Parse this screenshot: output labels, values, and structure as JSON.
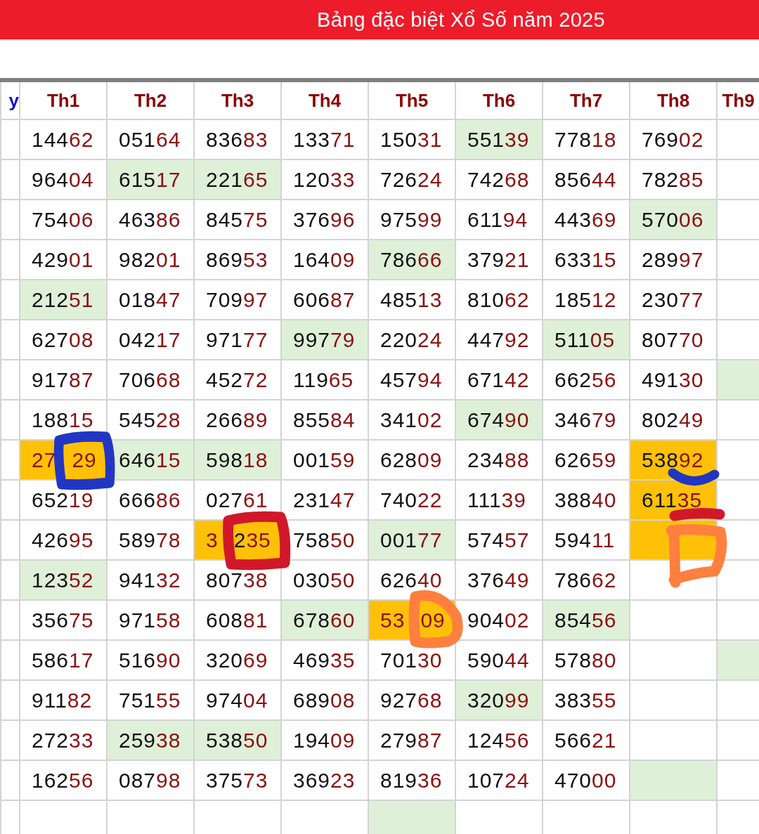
{
  "title": "Bảng đặc biệt Xổ Số năm 2025",
  "table": {
    "columns": [
      "y",
      "Th1",
      "Th2",
      "Th3",
      "Th4",
      "Th5",
      "Th6",
      "Th7",
      "Th8",
      "Th9"
    ],
    "rows": [
      [
        {},
        {
          "parts": [
            "14462"
          ]
        },
        {
          "parts": [
            "05164"
          ]
        },
        {
          "parts": [
            "83683"
          ]
        },
        {
          "parts": [
            "13371"
          ]
        },
        {
          "parts": [
            "15031"
          ]
        },
        {
          "parts": [
            "55139"
          ],
          "color": "#dff0d8"
        },
        {
          "parts": [
            "77818"
          ]
        },
        {
          "parts": [
            "76902"
          ]
        },
        {}
      ],
      [
        {},
        {
          "parts": [
            "96404"
          ]
        },
        {
          "parts": [
            "61517"
          ],
          "color": "#dff0d8"
        },
        {
          "parts": [
            "22165"
          ],
          "color": "#dff0d8"
        },
        {
          "parts": [
            "12033"
          ]
        },
        {
          "parts": [
            "72624"
          ]
        },
        {
          "parts": [
            "74268"
          ]
        },
        {
          "parts": [
            "85644"
          ]
        },
        {
          "parts": [
            "78285"
          ]
        },
        {}
      ],
      [
        {},
        {
          "parts": [
            "75406"
          ]
        },
        {
          "parts": [
            "46386"
          ]
        },
        {
          "parts": [
            "84575"
          ]
        },
        {
          "parts": [
            "37696"
          ]
        },
        {
          "parts": [
            "97599"
          ]
        },
        {
          "parts": [
            "61194"
          ]
        },
        {
          "parts": [
            "44369"
          ]
        },
        {
          "parts": [
            "57006"
          ],
          "color": "#dff0d8"
        },
        {}
      ],
      [
        {},
        {
          "parts": [
            "42901"
          ]
        },
        {
          "parts": [
            "98201"
          ]
        },
        {
          "parts": [
            "86953"
          ]
        },
        {
          "parts": [
            "16409"
          ]
        },
        {
          "parts": [
            "78666"
          ],
          "color": "#dff0d8"
        },
        {
          "parts": [
            "37921"
          ]
        },
        {
          "parts": [
            "63315"
          ]
        },
        {
          "parts": [
            "28997"
          ]
        },
        {}
      ],
      [
        {},
        {
          "parts": [
            "21251"
          ],
          "color": "#dff0d8"
        },
        {
          "parts": [
            "01847"
          ]
        },
        {
          "parts": [
            "70997"
          ]
        },
        {
          "parts": [
            "60687"
          ]
        },
        {
          "parts": [
            "48513"
          ]
        },
        {
          "parts": [
            "81062"
          ]
        },
        {
          "parts": [
            "18512"
          ]
        },
        {
          "parts": [
            "23077"
          ]
        },
        {}
      ],
      [
        {},
        {
          "parts": [
            "62708"
          ]
        },
        {
          "parts": [
            "04217"
          ]
        },
        {
          "parts": [
            "97177"
          ]
        },
        {
          "parts": [
            "99779"
          ],
          "color": "#dff0d8"
        },
        {
          "parts": [
            "22024"
          ]
        },
        {
          "parts": [
            "44792"
          ]
        },
        {
          "parts": [
            "51105"
          ],
          "color": "#dff0d8"
        },
        {
          "parts": [
            "80770"
          ]
        },
        {}
      ],
      [
        {},
        {
          "parts": [
            "91787"
          ]
        },
        {
          "parts": [
            "70668"
          ]
        },
        {
          "parts": [
            "45272"
          ]
        },
        {
          "parts": [
            "11965"
          ]
        },
        {
          "parts": [
            "45794"
          ]
        },
        {
          "parts": [
            "67142"
          ]
        },
        {
          "parts": [
            "66256"
          ]
        },
        {
          "parts": [
            "49130"
          ]
        },
        {
          "color": "#dff0d8"
        }
      ],
      [
        {},
        {
          "parts": [
            "18815"
          ]
        },
        {
          "parts": [
            "54528"
          ]
        },
        {
          "parts": [
            "26689"
          ]
        },
        {
          "parts": [
            "85584"
          ]
        },
        {
          "parts": [
            "34102"
          ]
        },
        {
          "parts": [
            "67490"
          ],
          "color": "#dff0d8"
        },
        {
          "parts": [
            "34679"
          ]
        },
        {
          "parts": [
            "80249"
          ]
        },
        {}
      ],
      [
        {},
        {
          "parts": [
            "27",
            "29"
          ],
          "color": "#ffc107",
          "mark": {
            "kind": "ring",
            "color": "#2236c4"
          }
        },
        {
          "parts": [
            "64615"
          ],
          "color": "#dff0d8"
        },
        {
          "parts": [
            "59818"
          ],
          "color": "#dff0d8"
        },
        {
          "parts": [
            "00159"
          ]
        },
        {
          "parts": [
            "62809"
          ]
        },
        {
          "parts": [
            "23488"
          ]
        },
        {
          "parts": [
            "62659"
          ]
        },
        {
          "parts": [
            "53892"
          ],
          "color": "#ffc107",
          "mark": {
            "kind": "arc",
            "color": "#2236c4"
          }
        },
        {}
      ],
      [
        {},
        {
          "parts": [
            "65219"
          ]
        },
        {
          "parts": [
            "66686"
          ]
        },
        {
          "parts": [
            "02761"
          ]
        },
        {
          "parts": [
            "23147"
          ]
        },
        {
          "parts": [
            "74022"
          ]
        },
        {
          "parts": [
            "11139"
          ]
        },
        {
          "parts": [
            "38840"
          ]
        },
        {
          "parts": [
            "61135"
          ],
          "color": "#ffc107",
          "mark": {
            "kind": "bar",
            "color": "#d0182a"
          }
        },
        {}
      ],
      [
        {},
        {
          "parts": [
            "42695"
          ]
        },
        {
          "parts": [
            "58978"
          ]
        },
        {
          "parts": [
            "3",
            "235"
          ],
          "color": "#ffc107",
          "mark": {
            "kind": "ring",
            "color": "#d0182a"
          }
        },
        {
          "parts": [
            "75850"
          ]
        },
        {
          "parts": [
            "00177"
          ],
          "color": "#dff0d8"
        },
        {
          "parts": [
            "57457"
          ]
        },
        {
          "parts": [
            "59411"
          ]
        },
        {
          "color": "#ffc107",
          "mark": {
            "kind": "loop",
            "color": "#ff7f3f"
          }
        },
        {}
      ],
      [
        {},
        {
          "parts": [
            "12352"
          ],
          "color": "#dff0d8"
        },
        {
          "parts": [
            "94132"
          ]
        },
        {
          "parts": [
            "80738"
          ]
        },
        {
          "parts": [
            "03050"
          ]
        },
        {
          "parts": [
            "62640"
          ]
        },
        {
          "parts": [
            "37649"
          ]
        },
        {
          "parts": [
            "78662"
          ]
        },
        {},
        {}
      ],
      [
        {},
        {
          "parts": [
            "35675"
          ]
        },
        {
          "parts": [
            "97158"
          ]
        },
        {
          "parts": [
            "60881"
          ]
        },
        {
          "parts": [
            "67860"
          ],
          "color": "#dff0d8"
        },
        {
          "parts": [
            "53",
            "09"
          ],
          "color": "#ffc107",
          "mark": {
            "kind": "small-loop",
            "color": "#ff7f3f"
          }
        },
        {
          "parts": [
            "90402"
          ]
        },
        {
          "parts": [
            "85456"
          ],
          "color": "#dff0d8"
        },
        {},
        {}
      ],
      [
        {},
        {
          "parts": [
            "58617"
          ]
        },
        {
          "parts": [
            "51690"
          ]
        },
        {
          "parts": [
            "32069"
          ]
        },
        {
          "parts": [
            "46935"
          ]
        },
        {
          "parts": [
            "70130"
          ]
        },
        {
          "parts": [
            "59044"
          ]
        },
        {
          "parts": [
            "57880"
          ]
        },
        {},
        {
          "color": "#dff0d8"
        }
      ],
      [
        {},
        {
          "parts": [
            "91182"
          ]
        },
        {
          "parts": [
            "75155"
          ]
        },
        {
          "parts": [
            "97404"
          ]
        },
        {
          "parts": [
            "68908"
          ]
        },
        {
          "parts": [
            "92768"
          ]
        },
        {
          "parts": [
            "32099"
          ],
          "color": "#dff0d8"
        },
        {
          "parts": [
            "38355"
          ]
        },
        {},
        {}
      ],
      [
        {},
        {
          "parts": [
            "27233"
          ]
        },
        {
          "parts": [
            "25938"
          ],
          "color": "#dff0d8"
        },
        {
          "parts": [
            "53850"
          ],
          "color": "#dff0d8"
        },
        {
          "parts": [
            "19409"
          ]
        },
        {
          "parts": [
            "27987"
          ]
        },
        {
          "parts": [
            "12456"
          ]
        },
        {
          "parts": [
            "56621"
          ]
        },
        {},
        {}
      ],
      [
        {},
        {
          "parts": [
            "16256"
          ]
        },
        {
          "parts": [
            "08798"
          ]
        },
        {
          "parts": [
            "37573"
          ]
        },
        {
          "parts": [
            "36923"
          ]
        },
        {
          "parts": [
            "81936"
          ]
        },
        {
          "parts": [
            "10724"
          ]
        },
        {
          "parts": [
            "47000"
          ]
        },
        {
          "color": "#dff0d8"
        },
        {}
      ],
      [
        {},
        {},
        {},
        {},
        {},
        {
          "color": "#dff0d8"
        },
        {},
        {},
        {},
        {}
      ]
    ]
  }
}
